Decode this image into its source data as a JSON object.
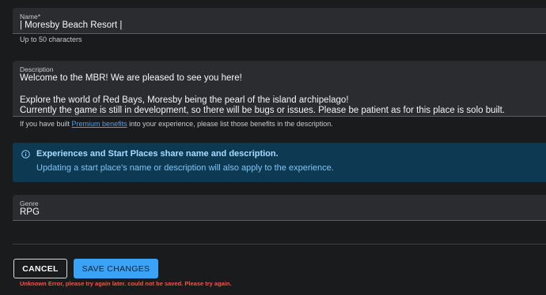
{
  "name_field": {
    "label": "Name",
    "required_marker": "*",
    "value": "| Moresby Beach Resort |",
    "helper": "Up to 50 characters"
  },
  "description_field": {
    "label": "Description",
    "lines": [
      "Welcome to the MBR! We are pleased to see you here!",
      "",
      "Explore the world of Red Bays, Moresby being the pearl of the island archipelago!",
      "Currently the game is still in development, so there will be bugs or issues. Please be patient as for this place is solo built."
    ],
    "helper_prefix": "If you have built ",
    "helper_link": "Premium benefits",
    "helper_suffix": " into your experience, please list those benefits in the description."
  },
  "info_box": {
    "title": "Experiences and Start Places share name and description.",
    "body": "Updating a start place’s name or description will also apply to the experience.",
    "icon": "info-icon"
  },
  "genre_field": {
    "label": "Genre",
    "value": "RPG"
  },
  "actions": {
    "cancel_label": "CANCEL",
    "save_label": "SAVE CHANGES"
  },
  "error_message": "Unknown Error, please try again later. could not be saved. Please try again.",
  "colors": {
    "background": "#191b1d",
    "field": "#2a2c30",
    "accent": "#3aa3f6",
    "info_bg": "#0d3a52",
    "error": "#ff4f43"
  }
}
